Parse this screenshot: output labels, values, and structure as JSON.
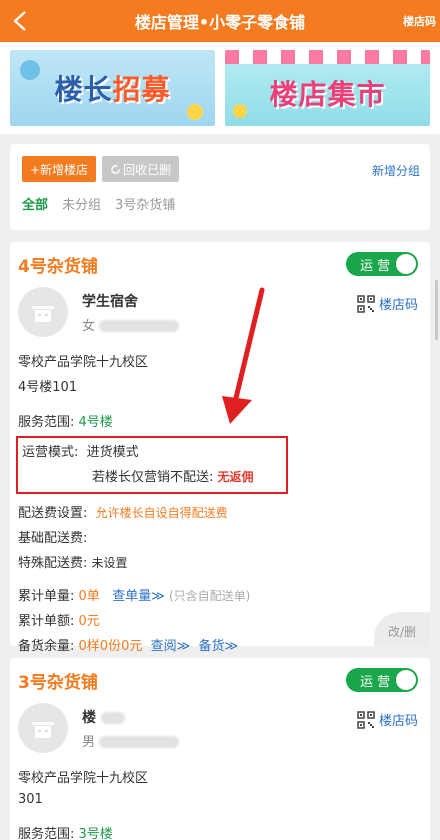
{
  "header": {
    "title": "楼店管理•小零子零食铺",
    "right_label": "楼店码",
    "back_icon": "chevron-left-icon",
    "bg_color": "#f47b20"
  },
  "banners": {
    "left_text_a": "楼长",
    "left_text_b": "招募",
    "right_text": "楼店集市"
  },
  "groups": {
    "add_shop_label": "+新增楼店",
    "recycle_label": "回收已删",
    "add_group_label": "新增分组",
    "tabs": [
      {
        "label": "全部",
        "active": true
      },
      {
        "label": "未分组",
        "active": false
      },
      {
        "label": "3号杂货铺",
        "active": false
      }
    ]
  },
  "shops": [
    {
      "name": "4号杂货铺",
      "status_label": "运 营",
      "owner_name": "学生宿舍",
      "owner_gender": "女",
      "qr_label": "楼店码",
      "school": "零校产品学院十九校区",
      "room": "4号楼101",
      "service_label": "服务范围:",
      "service_value": "4号楼",
      "mode_label": "运营模式:",
      "mode_value": "进货模式",
      "mode_note": "若楼长仅营销不配送:",
      "mode_note_value": "无返佣",
      "delivery_label": "配送费设置:",
      "delivery_value": "允许楼长自设自得配送费",
      "base_fee_label": "基础配送费:",
      "special_fee_label": "特殊配送费:",
      "special_fee_value": "未设置",
      "total_orders_label": "累计单量:",
      "total_orders_value": "0单",
      "total_orders_link": "查单量≫",
      "total_orders_note": "(只含自配送单)",
      "total_amount_label": "累计单额:",
      "total_amount_value": "0元",
      "stock_label": "备货余量:",
      "stock_value": "0样0份0元",
      "stock_link_view": "查阅≫",
      "stock_link_stock": "备货≫",
      "edit_label": "改/删"
    },
    {
      "name": "3号杂货铺",
      "status_label": "运 营",
      "owner_name": "楼",
      "owner_gender": "男",
      "qr_label": "楼店码",
      "school": "零校产品学院十九校区",
      "room": "301",
      "service_label": "服务范围:",
      "service_value": "3号楼"
    }
  ]
}
